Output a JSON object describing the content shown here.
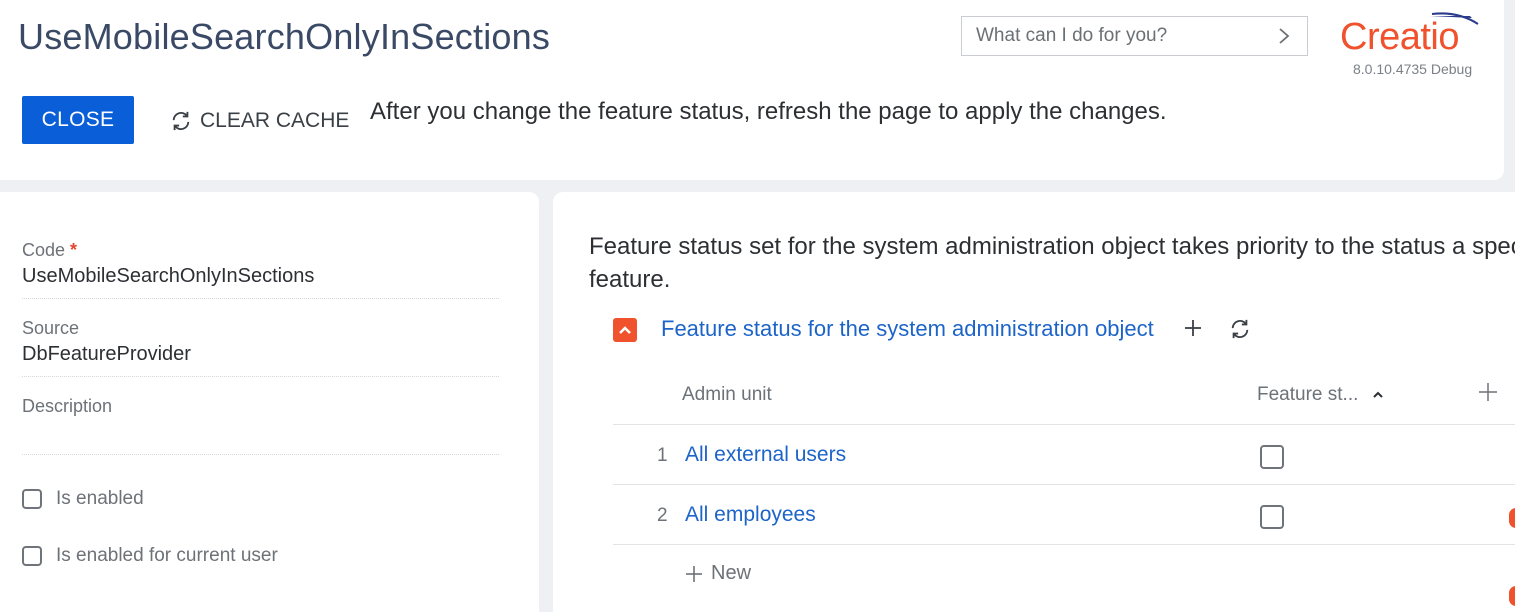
{
  "header": {
    "title": "UseMobileSearchOnlyInSections",
    "search_placeholder": "What can I do for you?",
    "logo_text": "Creatio",
    "version": "8.0.10.4735 Debug",
    "close_label": "CLOSE",
    "clear_cache_label": "CLEAR CACHE",
    "hint": "After you change the feature status, refresh the page to apply the changes."
  },
  "details": {
    "code_label": "Code",
    "code_required_mark": "*",
    "code_value": "UseMobileSearchOnlyInSections",
    "source_label": "Source",
    "source_value": "DbFeatureProvider",
    "description_label": "Description",
    "description_value": "",
    "is_enabled_label": "Is enabled",
    "is_enabled_checked": false,
    "is_enabled_current_user_label": "Is enabled for current user",
    "is_enabled_current_user_checked": false
  },
  "admin_panel": {
    "priority_text": "Feature status set for the system administration object takes priority to the status a specific feature.",
    "group_title": "Feature status for the system administration object",
    "columns": {
      "admin_unit": "Admin unit",
      "feature_status": "Feature st..."
    },
    "rows": [
      {
        "num": "1",
        "admin_unit": "All external users",
        "feature_status": false
      },
      {
        "num": "2",
        "admin_unit": "All employees",
        "feature_status": false
      }
    ],
    "new_label": "New"
  },
  "colors": {
    "primary": "#0a5ed7",
    "brand": "#f0522e",
    "link": "#1d64c9"
  }
}
